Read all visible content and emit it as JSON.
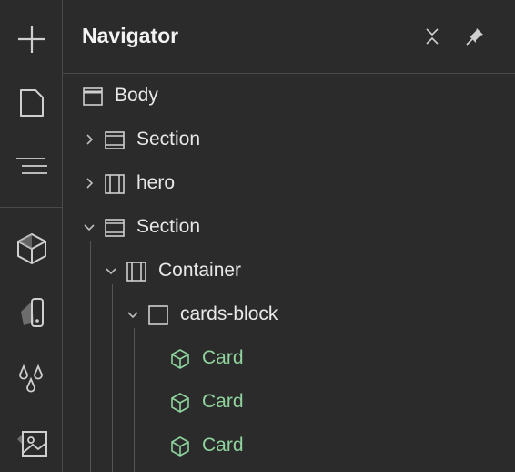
{
  "panel": {
    "title": "Navigator"
  },
  "rail": {
    "items": [
      {
        "icon": "plus-icon"
      },
      {
        "icon": "page-icon"
      },
      {
        "icon": "navigator-icon"
      },
      {
        "icon": "box-icon"
      },
      {
        "icon": "style-swatch-icon"
      },
      {
        "icon": "color-drops-icon"
      },
      {
        "icon": "image-assets-icon"
      }
    ]
  },
  "tree": {
    "nodes": [
      {
        "label": "Body",
        "icon": "body-icon"
      },
      {
        "label": "Section",
        "icon": "section-icon",
        "expanded": false
      },
      {
        "label": "hero",
        "icon": "container-icon",
        "expanded": false
      },
      {
        "label": "Section",
        "icon": "section-icon",
        "expanded": true
      },
      {
        "label": "Container",
        "icon": "container-icon",
        "expanded": true
      },
      {
        "label": "cards-block",
        "icon": "div-block-icon",
        "expanded": true
      },
      {
        "label": "Card",
        "icon": "component-icon"
      },
      {
        "label": "Card",
        "icon": "component-icon"
      },
      {
        "label": "Card",
        "icon": "component-icon"
      }
    ]
  },
  "colors": {
    "background": "#2b2b2b",
    "divider": "#4a4a4a",
    "text": "#e8e8e8",
    "component": "#8fd39d"
  }
}
